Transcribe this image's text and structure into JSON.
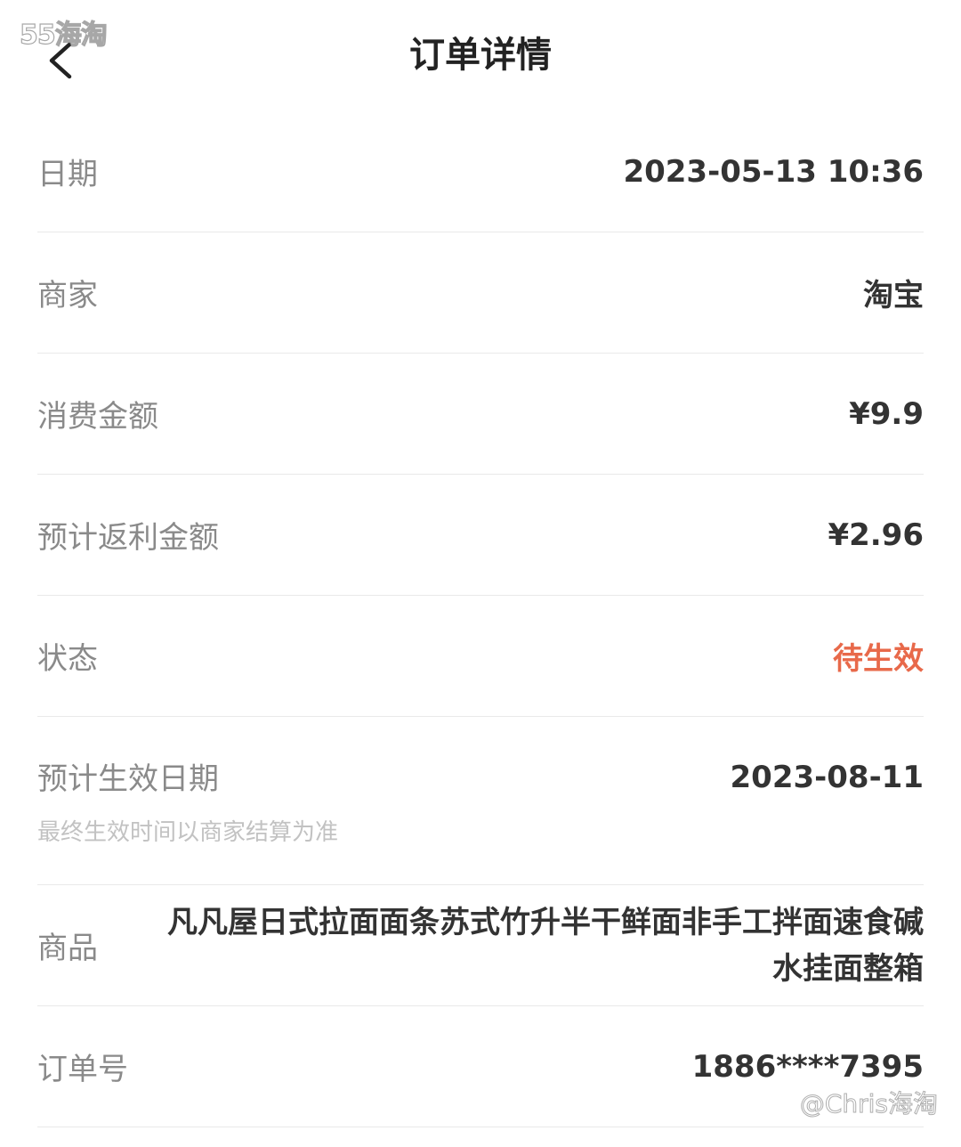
{
  "watermark": {
    "top": "55海淘",
    "bottom": "@Chris海淘"
  },
  "header": {
    "title": "订单详情"
  },
  "rows": {
    "date": {
      "label": "日期",
      "value": "2023-05-13 10:36"
    },
    "merchant": {
      "label": "商家",
      "value": "淘宝"
    },
    "amount": {
      "label": "消费金额",
      "value": "¥9.9"
    },
    "rebate": {
      "label": "预计返利金额",
      "value": "¥2.96"
    },
    "status": {
      "label": "状态",
      "value": "待生效"
    },
    "effective": {
      "label": "预计生效日期",
      "sublabel": "最终生效时间以商家结算为准",
      "value": "2023-08-11"
    },
    "product": {
      "label": "商品",
      "value": "凡凡屋日式拉面面条苏式竹升半干鲜面非手工拌面速食碱水挂面整箱"
    },
    "order_no": {
      "label": "订单号",
      "value": "1886****7395"
    }
  },
  "colors": {
    "status": "#e8694a",
    "label": "#8a8a8a",
    "value": "#333333"
  },
  "icons": {
    "back": "chevron-left-icon"
  }
}
